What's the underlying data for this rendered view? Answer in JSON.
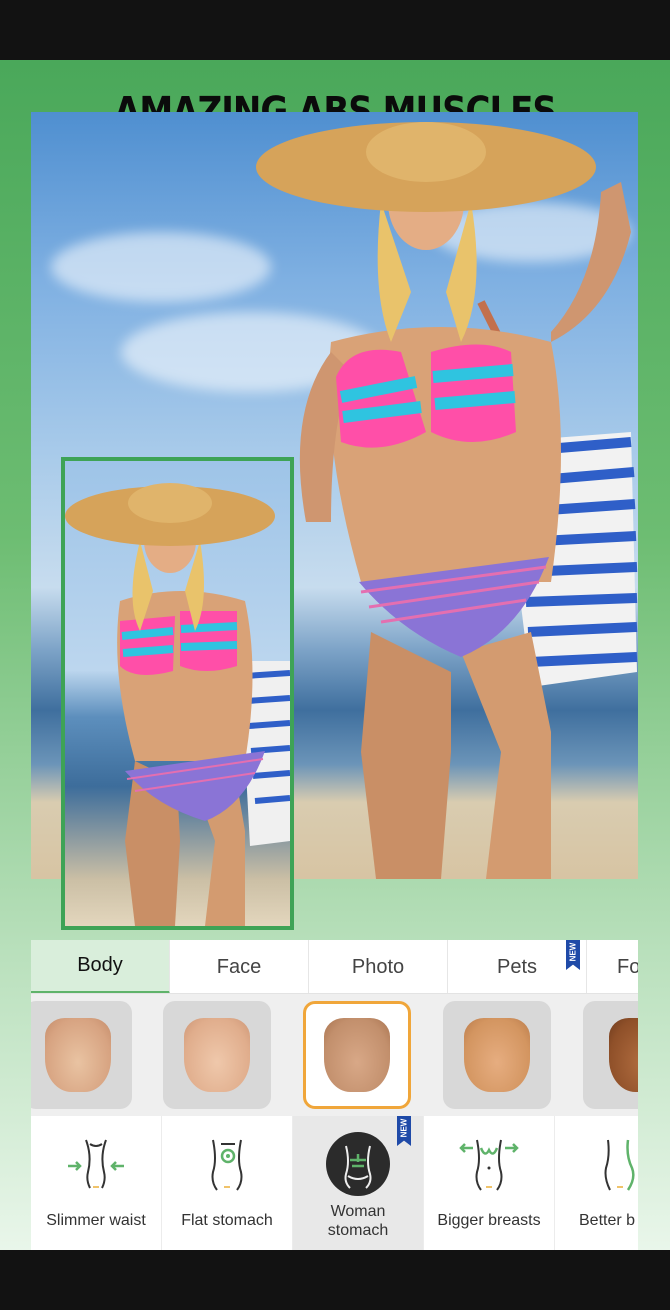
{
  "headline": "AMAZING ABS MUSCLES",
  "tabs": [
    {
      "label": "Body",
      "active": true
    },
    {
      "label": "Face"
    },
    {
      "label": "Photo"
    },
    {
      "label": "Pets",
      "badge": "NEW"
    },
    {
      "label": "Fo"
    }
  ],
  "thumbnails": [
    {
      "name": "torso-style-1",
      "skin": "#e0b38f"
    },
    {
      "name": "torso-style-2",
      "skin": "#e6b697"
    },
    {
      "name": "torso-style-3",
      "skin": "#c99472",
      "selected": true
    },
    {
      "name": "torso-style-4",
      "skin": "#d79a6a"
    },
    {
      "name": "torso-style-5",
      "skin": "#9a5a32"
    }
  ],
  "tools": [
    {
      "label": "Slimmer waist",
      "icon": "slimmer-waist-icon"
    },
    {
      "label": "Flat stomach",
      "icon": "flat-stomach-icon"
    },
    {
      "label": "Woman stomach",
      "icon": "woman-stomach-icon",
      "badge": "NEW",
      "active": true
    },
    {
      "label": "Bigger breasts",
      "icon": "bigger-breasts-icon"
    },
    {
      "label": "Better b",
      "icon": "better-body-icon"
    }
  ],
  "colors": {
    "accent": "#5fb36a",
    "selected_border": "#f0a63a",
    "badge": "#1f4aa8"
  }
}
